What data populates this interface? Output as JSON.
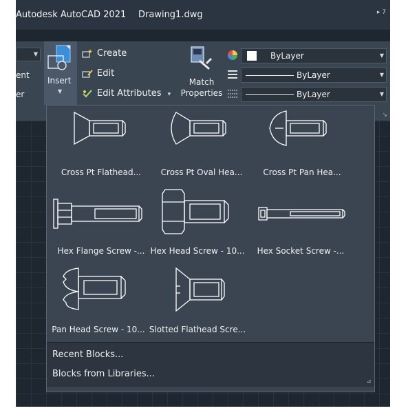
{
  "window": {
    "app_title": "Autodesk AutoCAD 2021",
    "file_name": "Drawing1.dwg",
    "right_glyph": "▸ 7"
  },
  "ribbon": {
    "left_stub": {
      "line1": "ent",
      "line2": "er"
    },
    "insert": {
      "label": "Insert"
    },
    "block_items": [
      {
        "label": "Create",
        "icon": "create-block-icon"
      },
      {
        "label": "Edit",
        "icon": "edit-block-icon"
      },
      {
        "label": "Edit Attributes",
        "icon": "edit-attributes-icon",
        "dropdown": "▾"
      }
    ],
    "match_properties": {
      "line1": "Match",
      "line2": "Properties"
    },
    "properties": [
      {
        "value": "ByLayer",
        "kind": "color",
        "swatch": "#ffffff"
      },
      {
        "value": "ByLayer",
        "kind": "lineweight"
      },
      {
        "value": "ByLayer",
        "kind": "linetype"
      }
    ]
  },
  "gallery": {
    "items": [
      {
        "label": "Cross Pt Flathead...",
        "icon": "cross-pt-flathead-screw-icon"
      },
      {
        "label": "Cross Pt Oval Hea...",
        "icon": "cross-pt-oval-head-screw-icon"
      },
      {
        "label": "Cross Pt Pan Hea...",
        "icon": "cross-pt-pan-head-screw-icon"
      },
      {
        "label": "Hex Flange Screw -...",
        "icon": "hex-flange-screw-icon"
      },
      {
        "label": "Hex Head Screw - 10...",
        "icon": "hex-head-screw-icon"
      },
      {
        "label": "Hex Socket  Screw -...",
        "icon": "hex-socket-screw-icon"
      },
      {
        "label": "Pan Head Screw - 10...",
        "icon": "pan-head-screw-icon"
      },
      {
        "label": "Slotted Flathead Scre...",
        "icon": "slotted-flathead-screw-icon"
      }
    ]
  },
  "menu": {
    "recent_blocks": "Recent Blocks...",
    "blocks_from_libraries": "Blocks from Libraries..."
  },
  "colors": {
    "accent": "#4b5869",
    "panel": "#3b4552",
    "titlebar": "#2b3441",
    "canvas": "#1e2630"
  }
}
